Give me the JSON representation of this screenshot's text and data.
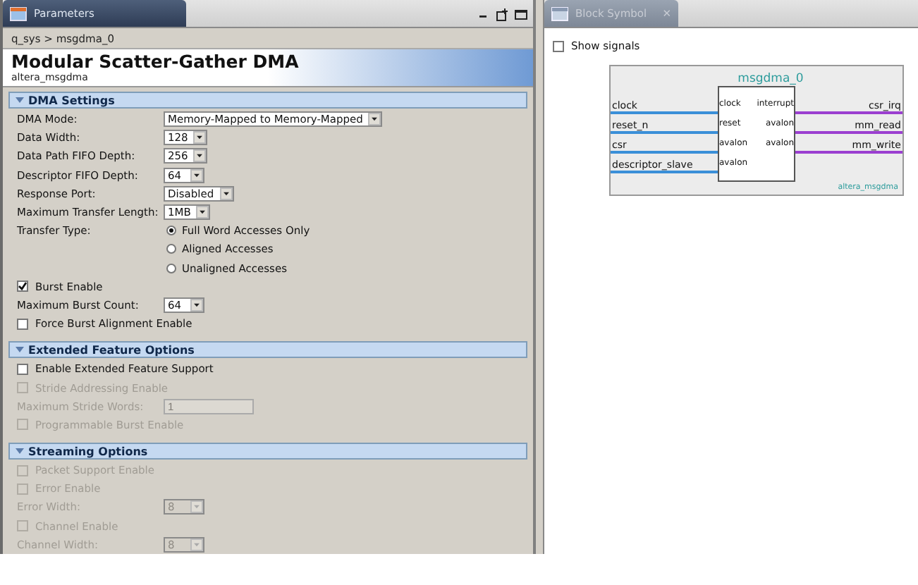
{
  "parameters_panel": {
    "tab": "Parameters",
    "breadcrumb": "q_sys > msgdma_0",
    "title": "Modular Scatter-Gather DMA",
    "subtitle": "altera_msgdma",
    "sections": [
      {
        "title": "DMA Settings",
        "expanded": true,
        "items": [
          {
            "kind": "dropdown",
            "label": "DMA Mode:",
            "value": "Memory-Mapped to Memory-Mapped",
            "disabled": false
          },
          {
            "kind": "dropdown",
            "label": "Data Width:",
            "value": "128",
            "disabled": false
          },
          {
            "kind": "dropdown",
            "label": "Data Path FIFO Depth:",
            "value": "256",
            "disabled": false
          },
          {
            "kind": "dropdown",
            "label": "Descriptor FIFO Depth:",
            "value": "64",
            "disabled": false
          },
          {
            "kind": "dropdown",
            "label": "Response Port:",
            "value": "Disabled",
            "disabled": false
          },
          {
            "kind": "dropdown",
            "label": "Maximum Transfer Length:",
            "value": "1MB",
            "disabled": false
          },
          {
            "kind": "radio",
            "label": "Transfer Type:",
            "options": [
              {
                "label": "Full Word Accesses Only",
                "selected": true
              },
              {
                "label": "Aligned Accesses",
                "selected": false
              },
              {
                "label": "Unaligned Accesses",
                "selected": false
              }
            ]
          },
          {
            "kind": "checkbox",
            "label": "Burst Enable",
            "checked": true,
            "disabled": false
          },
          {
            "kind": "dropdown",
            "label": "Maximum Burst Count:",
            "value": "64",
            "disabled": false
          },
          {
            "kind": "checkbox",
            "label": "Force Burst Alignment Enable",
            "checked": false,
            "disabled": false
          }
        ]
      },
      {
        "title": "Extended Feature Options",
        "expanded": true,
        "items": [
          {
            "kind": "checkbox",
            "label": "Enable Extended Feature Support",
            "checked": false,
            "disabled": false
          },
          {
            "kind": "checkbox",
            "label": "Stride Addressing Enable",
            "checked": false,
            "disabled": true
          },
          {
            "kind": "textfield",
            "label": "Maximum Stride Words:",
            "value": "1",
            "disabled": true
          },
          {
            "kind": "checkbox",
            "label": "Programmable Burst Enable",
            "checked": false,
            "disabled": true
          }
        ]
      },
      {
        "title": "Streaming Options",
        "expanded": true,
        "items": [
          {
            "kind": "checkbox",
            "label": "Packet Support Enable",
            "checked": false,
            "disabled": true
          },
          {
            "kind": "checkbox",
            "label": "Error Enable",
            "checked": false,
            "disabled": true
          },
          {
            "kind": "dropdown",
            "label": "Error Width:",
            "value": "8",
            "disabled": true
          },
          {
            "kind": "checkbox",
            "label": "Channel Enable",
            "checked": false,
            "disabled": true
          },
          {
            "kind": "dropdown",
            "label": "Channel Width:",
            "value": "8",
            "disabled": true
          }
        ]
      }
    ]
  },
  "block_symbol_panel": {
    "tab": "Block Symbol",
    "tab_close": "✕",
    "show_signals": {
      "label": "Show signals",
      "checked": false
    },
    "block": {
      "name": "msgdma_0",
      "type": "altera_msgdma",
      "inputs": [
        {
          "signal": "clock",
          "port": "clock"
        },
        {
          "signal": "reset_n",
          "port": "reset"
        },
        {
          "signal": "csr",
          "port": "avalon"
        },
        {
          "signal": "descriptor_slave",
          "port": "avalon"
        }
      ],
      "outputs": [
        {
          "port": "interrupt",
          "signal": "csr_irq"
        },
        {
          "port": "avalon",
          "signal": "mm_read"
        },
        {
          "port": "avalon",
          "signal": "mm_write"
        }
      ]
    }
  }
}
